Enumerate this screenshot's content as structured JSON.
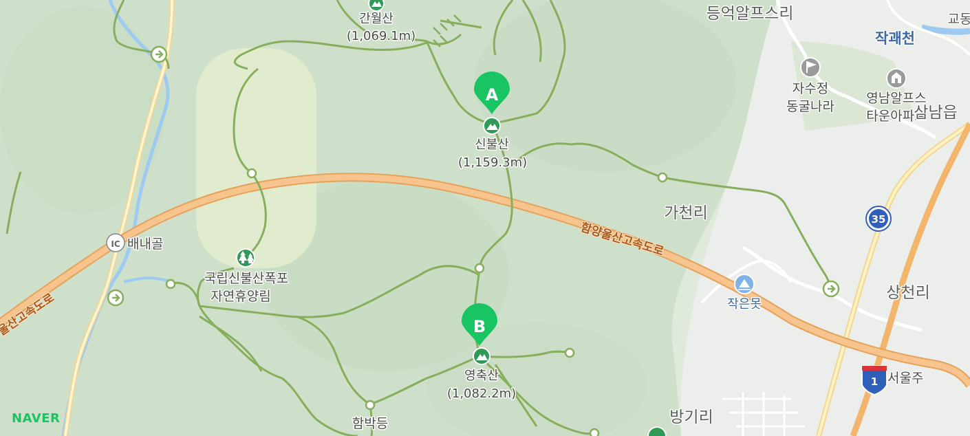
{
  "map": {
    "provider_logo": "NAVER",
    "colors": {
      "land": "#e9eee8",
      "forest": "#d3e4cf",
      "trail": "#86ae5c",
      "expressway": "#f2b56b",
      "road": "#ffffff",
      "water": "#9dcaf1",
      "marker": "#19c463",
      "route_shield": "#2f5fb8"
    },
    "markers": [
      {
        "letter": "A",
        "peak_name": "신불산",
        "elevation": "(1,159.3m)"
      },
      {
        "letter": "B",
        "peak_name": "영축산",
        "elevation": "(1,082.2m)"
      }
    ],
    "peaks": [
      {
        "name": "간월산",
        "elevation": "(1,069.1m)"
      }
    ],
    "highway_labels": [
      "함양울산고속도로",
      "울산고속도로"
    ],
    "place_labels": {
      "baenaegol": "배내골",
      "recreation_forest_line1": "국립신불산폭포",
      "recreation_forest_line2": "자연휴양림",
      "hambakdeung": "함박등",
      "deungeok_alps_ri": "등억알프스리",
      "jakgwacheon": "작괘천",
      "jasujeong_line1": "자수정",
      "jasujeong_line2": "동굴나라",
      "yeongnam_alps_line1": "영남알프스",
      "yeongnam_alps_line2": "타운아파트",
      "samnam_eup": "삼남읍",
      "gacheon_ri": "가천리",
      "sangcheon_ri": "상천리",
      "jageunmot": "작은못",
      "seoulju": "서울주",
      "banggi_ri": "방기리",
      "top_right_partial": "교동"
    },
    "icons": {
      "ic_badge": "IC",
      "route_35": "35",
      "route_1": "1"
    }
  }
}
